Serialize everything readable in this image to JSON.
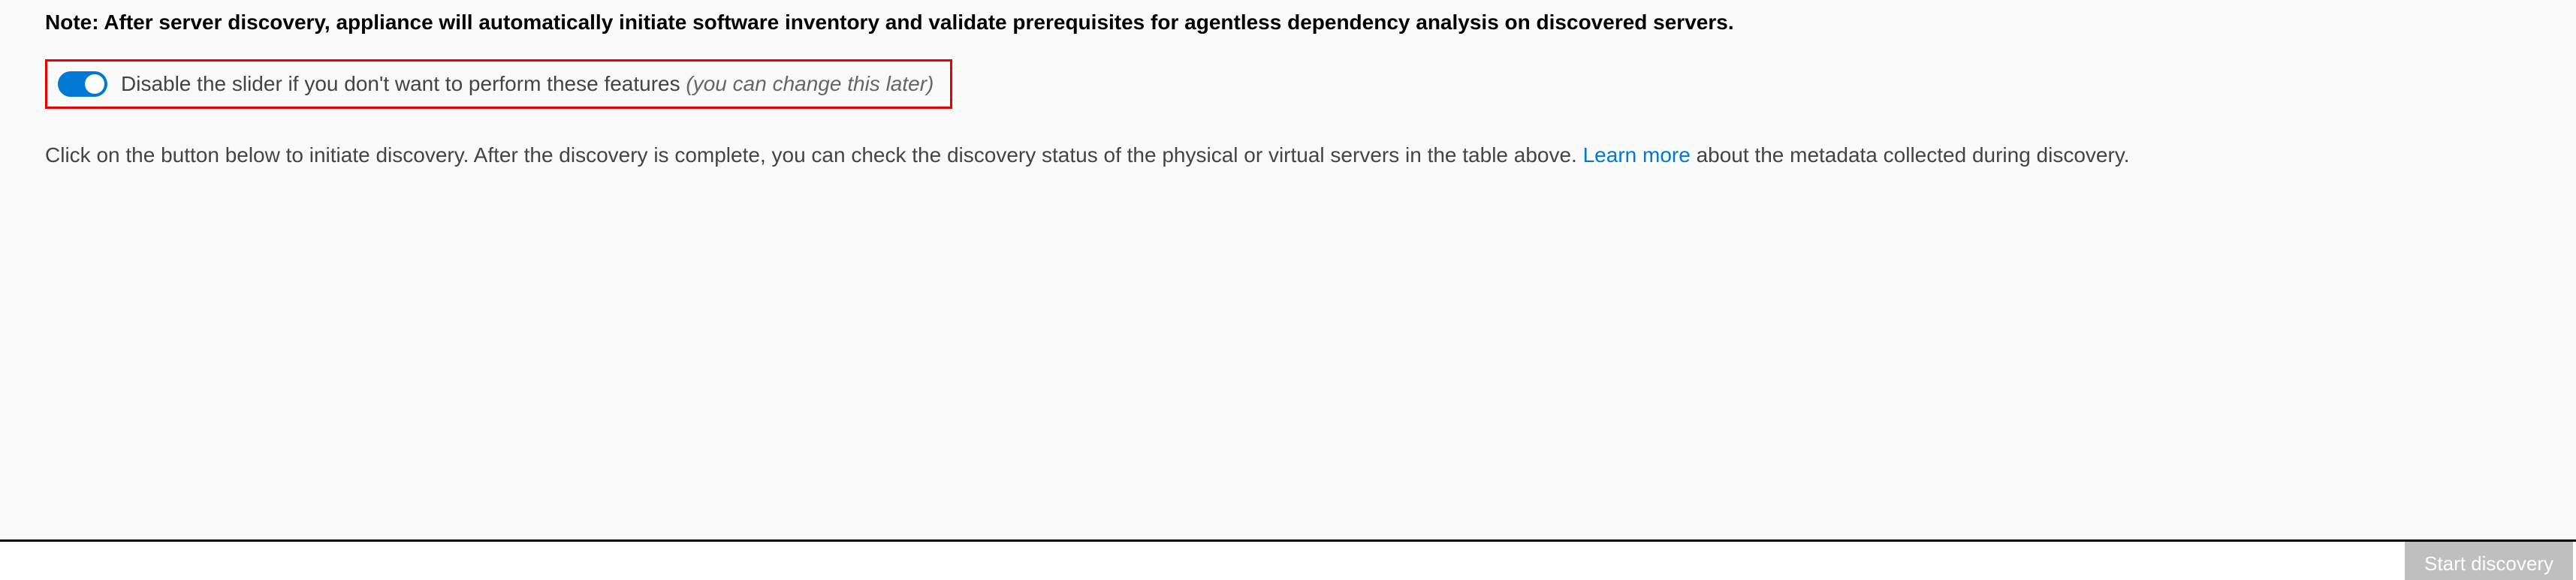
{
  "note": "Note: After server discovery, appliance will automatically initiate software inventory and validate prerequisites for agentless dependency analysis on discovered servers.",
  "toggle": {
    "label": "Disable the slider if you don't want to perform these features ",
    "hint": "(you can change this later)",
    "state": "on"
  },
  "instruction": {
    "prefix": "Click on the button below to initiate discovery. After the discovery is complete, you can check the discovery status of the physical or virtual servers in the table above. ",
    "link": "Learn more",
    "suffix": " about the metadata collected during discovery."
  },
  "button": {
    "start_label": "Start discovery"
  }
}
